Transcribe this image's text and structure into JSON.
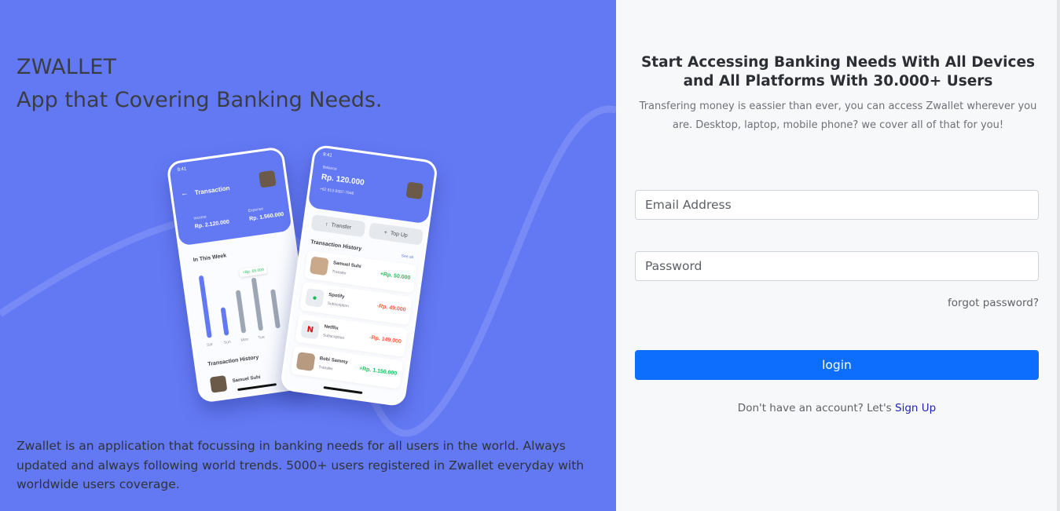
{
  "brand": {
    "name": "ZWALLET",
    "tagline": "App that Covering Banking Needs.",
    "description": "Zwallet is an application that focussing in banking needs for all users in the world. Always updated and always following world trends. 5000+ users registered in Zwallet everyday with worldwide users coverage.",
    "color": "#6379f4"
  },
  "phone1": {
    "time": "9:41",
    "title": "Transaction",
    "income_label": "Income",
    "income_value": "Rp. 2.120.000",
    "expense_label": "Expense",
    "expense_value": "Rp. 1.560.000",
    "week_title": "In This Week",
    "highlight": "+Rp. 65.000",
    "days": [
      "Sat",
      "Sun",
      "Mon",
      "Tue"
    ],
    "history_title": "Transaction History",
    "first_item": "Samuel Suhi"
  },
  "phone2": {
    "time": "9:41",
    "balance_label": "Balance",
    "balance_value": "Rp. 120.000",
    "phone": "+62 813-9387-7946",
    "transfer": "Transfer",
    "topup": "Top Up",
    "history_title": "Transaction History",
    "see_all": "See all",
    "items": [
      {
        "name": "Samuel Suhi",
        "type": "Transfer",
        "amount": "+Rp. 50.000",
        "color": "#1ec15f",
        "icon": "avatar-icon"
      },
      {
        "name": "Spotify",
        "type": "Subscription",
        "amount": "-Rp. 49.000",
        "color": "#ff5b37",
        "icon": "spotify-icon"
      },
      {
        "name": "Netflix",
        "type": "Subscription",
        "amount": "-Rp. 149.000",
        "color": "#ff5b37",
        "icon": "netflix-icon"
      },
      {
        "name": "Bobi Sammy",
        "type": "Transfer",
        "amount": "+Rp. 1.150.000",
        "color": "#1ec15f",
        "icon": "avatar-icon"
      }
    ]
  },
  "form": {
    "heading": "Start Accessing Banking Needs With All Devices and All Platforms With 30.000+ Users",
    "subheading": "Transfering money is eassier than ever, you can access Zwallet wherever you are. Desktop, laptop, mobile phone? we cover all of that for you!",
    "email_placeholder": "Email Address",
    "password_placeholder": "Password",
    "forgot": "forgot password?",
    "login": "login",
    "no_account": "Don't have an account? Let's",
    "signup": "Sign Up",
    "button_color": "#0d6efd"
  }
}
